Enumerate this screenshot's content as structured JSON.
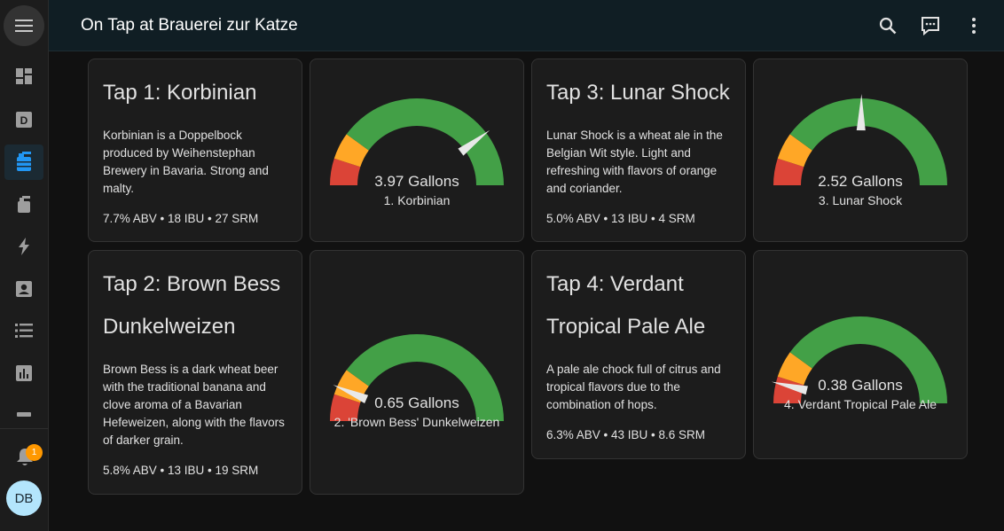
{
  "header": {
    "title": "On Tap at Brauerei zur Katze"
  },
  "icons": {
    "menu": "menu-icon",
    "search": "search-icon",
    "assist": "assist-icon",
    "more": "more-vert-icon",
    "nav": [
      "dashboard-icon",
      "d-letter-icon",
      "keg-icon",
      "tap-icon",
      "energy-icon",
      "contact-card-icon",
      "list-icon",
      "chart-icon",
      "tray-icon"
    ]
  },
  "sidebar": {
    "notification_count": "1",
    "avatar_initials": "DB"
  },
  "colors": {
    "green": "#43a047",
    "orange": "#ffa726",
    "red": "#db4437",
    "needle": "#e8e8e8"
  },
  "taps": [
    {
      "title_line1": "Tap 1: Korbinian",
      "title_line2": "",
      "description": "Korbinian is a Doppelbock produced by Weihenstephan Brewery in Bavaria. Strong and malty.",
      "stats": "7.7% ABV • 18 IBU • 27 SRM",
      "gauge_value": 3.97,
      "gauge_value_text": "3.97 Gallons",
      "gauge_name": "1. Korbinian"
    },
    {
      "title_line1": "Tap 2: Brown Bess",
      "title_line2": "Dunkelweizen",
      "description": "Brown Bess is a dark wheat beer with the traditional banana and clove aroma of a Bavarian Hefeweizen, along with the flavors of darker grain.",
      "stats": "5.8% ABV • 13 IBU • 19 SRM",
      "gauge_value": 0.65,
      "gauge_value_text": "0.65 Gallons",
      "gauge_name": "2. 'Brown Bess' Dunkelweizen"
    },
    {
      "title_line1": "Tap 3: Lunar Shock",
      "title_line2": "",
      "description": "Lunar Shock is a wheat ale in the Belgian Wit style. Light and refreshing with flavors of orange and coriander.",
      "stats": "5.0% ABV • 13 IBU • 4 SRM",
      "gauge_value": 2.52,
      "gauge_value_text": "2.52 Gallons",
      "gauge_name": "3. Lunar Shock"
    },
    {
      "title_line1": "Tap 4: Verdant",
      "title_line2": "Tropical Pale Ale",
      "description": "A pale ale chock full of citrus and tropical flavors due to the combination of hops.",
      "stats": "6.3% ABV • 43 IBU • 8.6 SRM",
      "gauge_value": 0.38,
      "gauge_value_text": "0.38 Gallons",
      "gauge_name": "4. Verdant Tropical Pale Ale"
    }
  ],
  "gauge_scale": {
    "min": 0,
    "max": 5,
    "severity": {
      "red_below": 0.5,
      "orange_below": 1
    }
  }
}
